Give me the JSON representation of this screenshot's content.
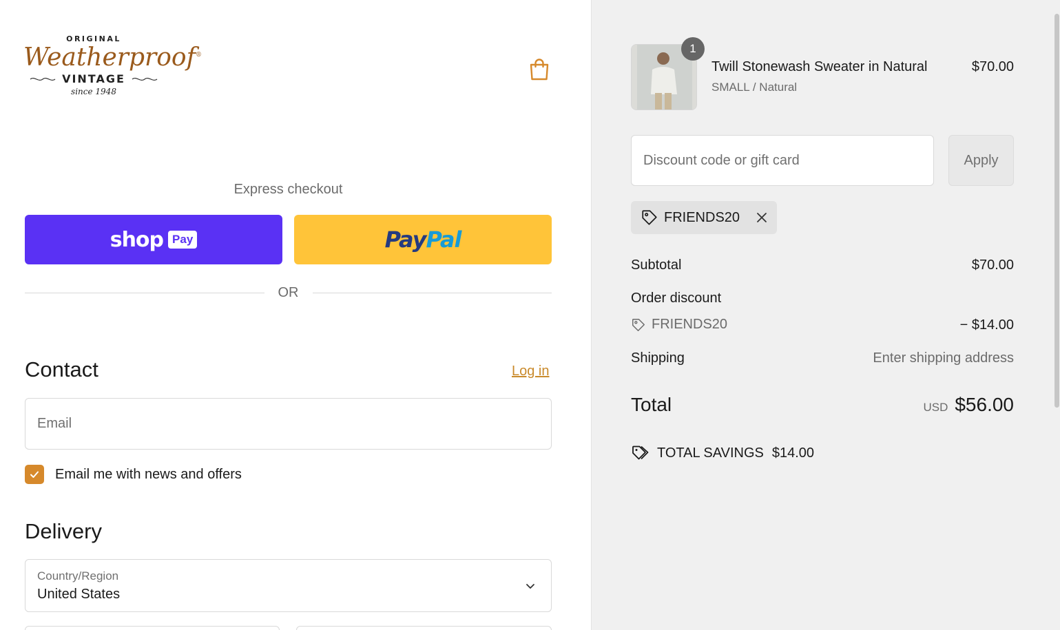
{
  "brand": {
    "logo_top": "ORIGINAL",
    "logo_name": "Weatherproof",
    "logo_vintage": "VINTAGE",
    "logo_since": "since 1948"
  },
  "express": {
    "label": "Express checkout",
    "shop_word": "shop",
    "shop_pay": "Pay",
    "paypal_1": "Pay",
    "paypal_2": "Pal",
    "or": "OR"
  },
  "contact": {
    "title": "Contact",
    "login": "Log in",
    "email_placeholder": "Email",
    "news_label": "Email me with news and offers",
    "news_checked": true
  },
  "delivery": {
    "title": "Delivery",
    "country_label": "Country/Region",
    "country_value": "United States"
  },
  "cart": {
    "quantity": "1",
    "product_title": "Twill Stonewash Sweater in Natural",
    "variant": "SMALL / Natural",
    "price": "$70.00"
  },
  "discount": {
    "placeholder": "Discount code or gift card",
    "apply": "Apply",
    "applied_code": "FRIENDS20"
  },
  "summary": {
    "subtotal_label": "Subtotal",
    "subtotal_value": "$70.00",
    "order_discount_label": "Order discount",
    "discount_code": "FRIENDS20",
    "discount_value": "− $14.00",
    "shipping_label": "Shipping",
    "shipping_value": "Enter shipping address",
    "total_label": "Total",
    "currency": "USD",
    "total_value": "$56.00",
    "savings_label": "TOTAL SAVINGS",
    "savings_value": "$14.00"
  },
  "colors": {
    "accent": "#c98a2b",
    "shop_pay": "#5a31f4",
    "paypal": "#ffc439",
    "checkbox": "#d6892b"
  }
}
